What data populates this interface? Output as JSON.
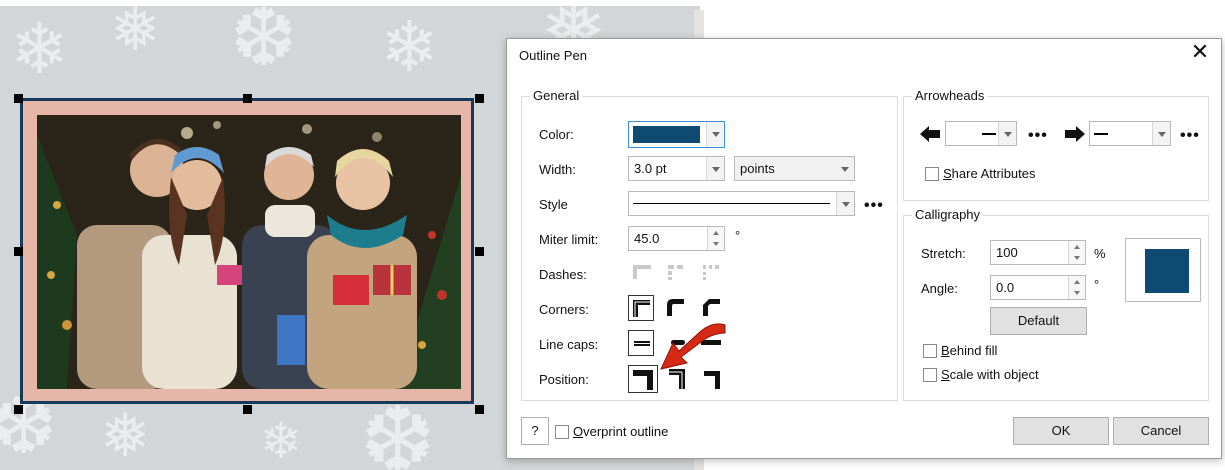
{
  "dialog": {
    "title": "Outline Pen",
    "close_glyph": "✕"
  },
  "general": {
    "group_title": "General",
    "color_label": "Color:",
    "color_value": "#0f4a73",
    "width_label": "Width:",
    "width_value": "3.0 pt",
    "width_units": "points",
    "style_label": "Style",
    "miter_label": "Miter limit:",
    "miter_value": "45.0",
    "miter_unit": "°",
    "dashes_label": "Dashes:",
    "corners_label": "Corners:",
    "line_caps_label": "Line caps:",
    "position_label": "Position:",
    "more_glyph": "•••"
  },
  "arrowheads": {
    "group_title": "Arrowheads",
    "share_label_pre": "",
    "share_label_u": "S",
    "share_label_post": "hare Attributes",
    "more_glyph": "•••"
  },
  "calligraphy": {
    "group_title": "Calligraphy",
    "stretch_label": "Stretch:",
    "stretch_value": "100",
    "stretch_unit": "%",
    "angle_label": "Angle:",
    "angle_value": "0.0",
    "angle_unit": "°",
    "default_button": "Default",
    "preview_color": "#0f4a73",
    "behind_fill_u": "B",
    "behind_fill_post": "ehind fill",
    "scale_u": "S",
    "scale_post": "cale with object"
  },
  "footer": {
    "help_label": "?",
    "overprint_u": "O",
    "overprint_post": "verprint outline",
    "ok_label": "OK",
    "cancel_label": "Cancel"
  },
  "annotation": {
    "arrow_color": "#d42a14"
  },
  "canvas": {
    "frame_color": "#16385a",
    "mat_color": "#e6b7a8"
  }
}
